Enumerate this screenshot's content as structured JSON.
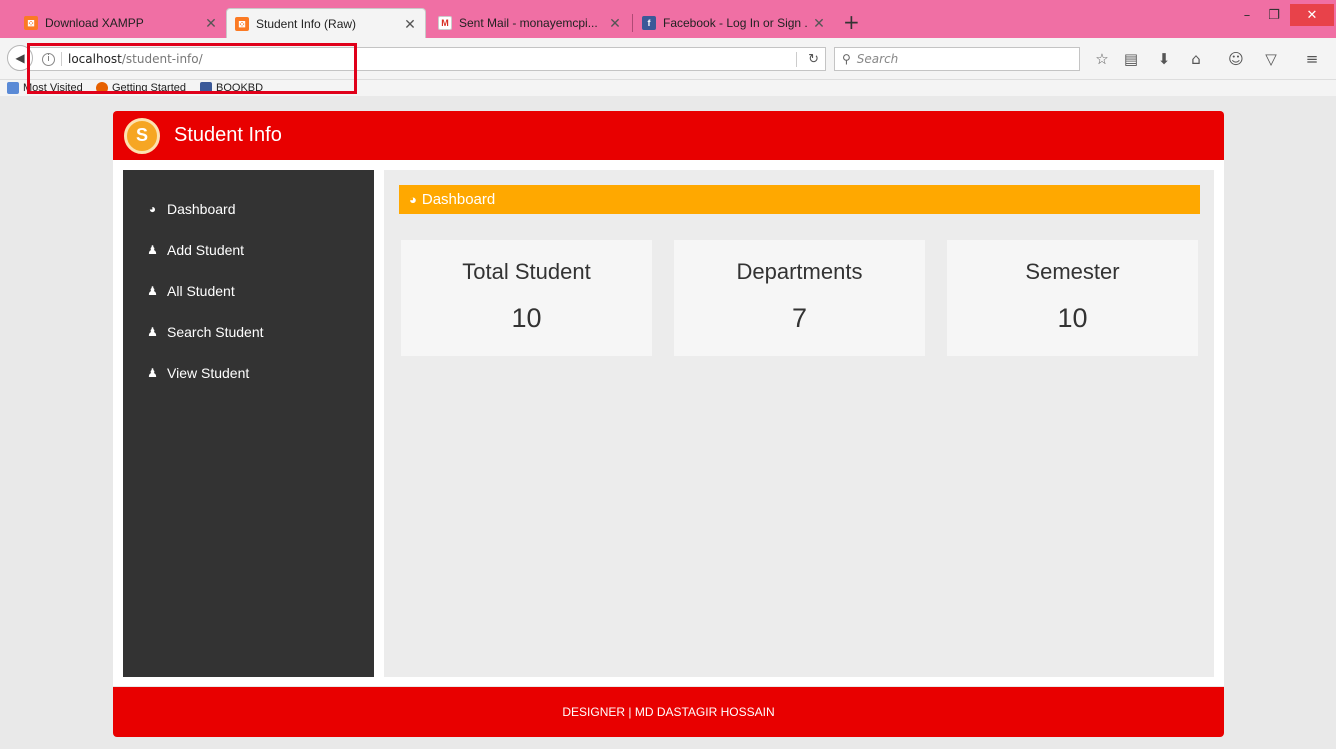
{
  "browser": {
    "tabs": [
      {
        "title": "Download XAMPP",
        "icon": "xampp-icon",
        "active": false
      },
      {
        "title": "Student Info (Raw)",
        "icon": "xampp-icon",
        "active": true
      },
      {
        "title": "Sent Mail - monayemcpi...",
        "icon": "gmail-icon",
        "active": false
      },
      {
        "title": "Facebook - Log In or Sign ...",
        "icon": "facebook-icon",
        "active": false
      }
    ],
    "new_tab_label": "+",
    "url_host": "localhost",
    "url_path": "/student-info/",
    "search_placeholder": "Search",
    "bookmarks": [
      {
        "label": "Most Visited",
        "icon": "bookmark-folder-icon"
      },
      {
        "label": "Getting Started",
        "icon": "firefox-icon"
      },
      {
        "label": "BOOKBD",
        "icon": "facebook-icon"
      }
    ],
    "colors": {
      "tabbar": "#f06fa4",
      "highlight": "#e0001a"
    }
  },
  "app": {
    "logo_letter": "S",
    "brand": "Student Info",
    "sidebar": [
      {
        "label": "Dashboard",
        "icon": "dashboard-icon"
      },
      {
        "label": "Add Student",
        "icon": "user-icon"
      },
      {
        "label": "All Student",
        "icon": "user-icon"
      },
      {
        "label": "Search Student",
        "icon": "user-icon"
      },
      {
        "label": "View Student",
        "icon": "user-icon"
      }
    ],
    "section_title": "Dashboard",
    "cards": [
      {
        "label": "Total Student",
        "value": "10"
      },
      {
        "label": "Departments",
        "value": "7"
      },
      {
        "label": "Semester",
        "value": "10"
      }
    ],
    "footer": "DESIGNER | MD DASTAGIR HOSSAIN",
    "colors": {
      "header": "#e80000",
      "sidebar": "#333333",
      "section_bar": "#ffa800",
      "footer": "#e80000"
    }
  }
}
